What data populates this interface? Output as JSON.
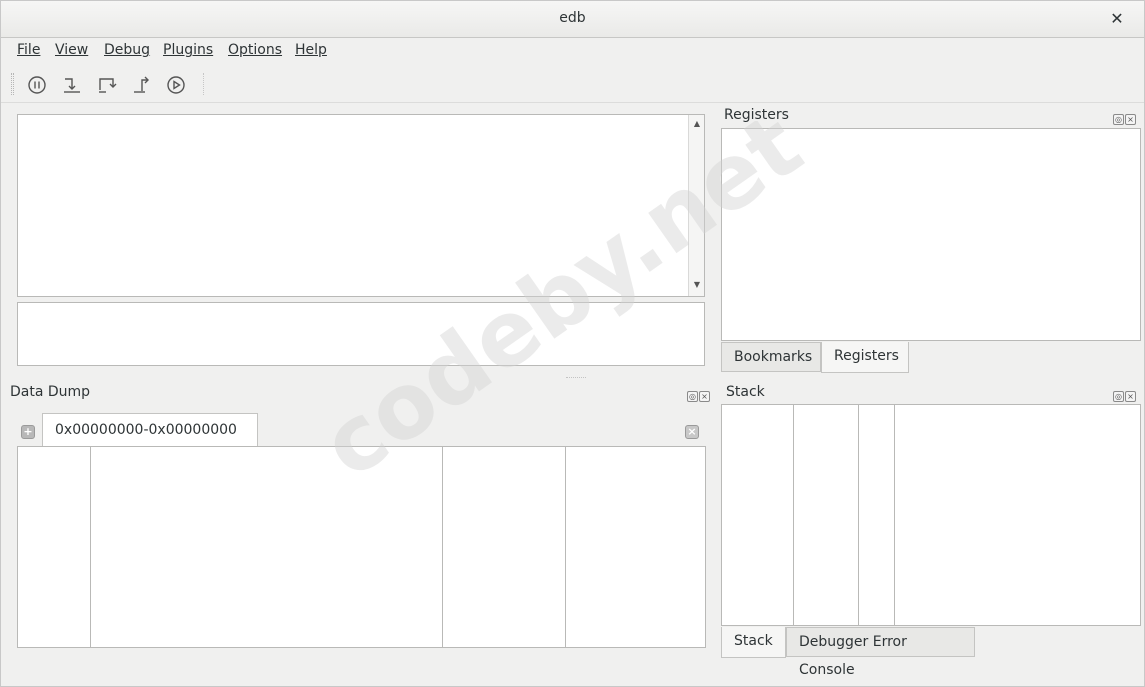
{
  "window": {
    "title": "edb"
  },
  "menu": [
    {
      "label": "File"
    },
    {
      "label": "View"
    },
    {
      "label": "Debug"
    },
    {
      "label": "Plugins"
    },
    {
      "label": "Options"
    },
    {
      "label": "Help"
    }
  ],
  "toolbar": {
    "buttons": [
      {
        "icon": "pause-icon"
      },
      {
        "icon": "step-into-icon"
      },
      {
        "icon": "step-over-icon"
      },
      {
        "icon": "step-out-icon"
      },
      {
        "icon": "run-icon"
      }
    ]
  },
  "registers_dock": {
    "title": "Registers",
    "tabs": [
      "Bookmarks",
      "Registers"
    ],
    "active_tab": "Registers"
  },
  "data_dump_dock": {
    "title": "Data Dump",
    "tab_label": "0x00000000-0x00000000"
  },
  "stack_dock": {
    "title": "Stack",
    "tabs": [
      "Stack",
      "Debugger Error Console"
    ],
    "active_tab": "Stack"
  },
  "watermark": "codeby.net"
}
